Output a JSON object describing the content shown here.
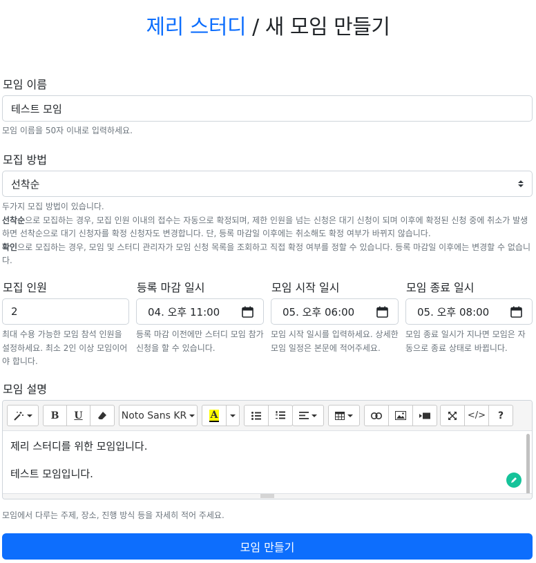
{
  "title": {
    "brand": "제리 스터디",
    "separator": " / ",
    "page": "새 모임 만들기"
  },
  "form": {
    "name": {
      "label": "모임 이름",
      "value": "테스트 모임",
      "help": "모임 이름을 50자 이내로 입력하세요."
    },
    "method": {
      "label": "모집 방법",
      "value": "선착순",
      "help_intro": "두가지 모집 방법이 있습니다.",
      "help_fcfs_term": "선착순",
      "help_fcfs_text": "으로 모집하는 경우, 모집 인원 이내의 접수는 자동으로 확정되며, 제한 인원을 넘는 신청은 대기 신청이 되며 이후에 확정된 신청 중에 취소가 발생하면 선착순으로 대기 신청자를 확정 신청자도 변경합니다. 단, 등록 마감일 이후에는 취소해도 확정 여부가 바뀌지 않습니다.",
      "help_confirm_term": "확인",
      "help_confirm_text": "으로 모집하는 경우, 모임 및 스터디 관리자가 모임 신청 목록을 조회하고 직접 확정 여부를 정할 수 있습니다. 등록 마감일 이후에는 변경할 수 없습니다."
    },
    "limit": {
      "label": "모집 인원",
      "value": "2",
      "help": "최대 수용 가능한 모임 참석 인원을 설정하세요. 최소 2인 이상 모임이어야 합니다."
    },
    "deadline": {
      "label": "등록 마감 일시",
      "value": "04. 오후 11:00",
      "help": "등록 마감 이전에만 스터디 모임 참가 신청을 할 수 있습니다."
    },
    "start": {
      "label": "모임 시작 일시",
      "value": "05. 오후 06:00",
      "help": "모임 시작 일시를 입력하세요. 상세한 모임 일정은 본문에 적어주세요."
    },
    "end": {
      "label": "모임 종료 일시",
      "value": "05. 오후 08:00",
      "help": "모임 종료 일시가 지나면 모임은 자동으로 종료 상태로 바뀝니다."
    },
    "description": {
      "label": "모임 설명",
      "font_name": "Noto Sans KR",
      "line1": "제리 스터디를 위한 모임입니다.",
      "line2": "테스트 모임입니다.",
      "help": "모임에서 다루는 주제, 장소, 진행 방식 등을 자세히 적어 주세요."
    },
    "submit_label": "모임 만들기"
  },
  "icons": [
    "magic-icon",
    "bold-icon",
    "underline-icon",
    "eraser-icon",
    "font-color-icon",
    "bullet-list-icon",
    "numbered-list-icon",
    "align-icon",
    "table-icon",
    "link-icon",
    "image-icon",
    "video-icon",
    "fullscreen-icon",
    "code-view-icon",
    "help-icon",
    "calendar-icon",
    "grammarly-icon"
  ],
  "colors": {
    "primary": "#0d6efd",
    "help_text": "#6c757d",
    "highlight": "#ffff00",
    "grammarly": "#15c39a"
  }
}
